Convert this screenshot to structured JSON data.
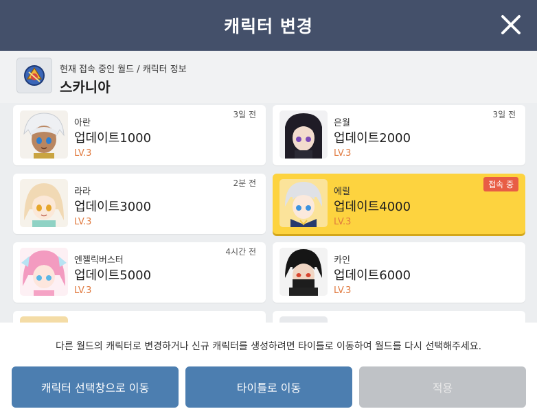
{
  "header": {
    "title": "캐릭터 변경"
  },
  "world": {
    "caption": "현재 접속 중인 월드 / 캐릭터 정보",
    "name": "스카니아"
  },
  "characters": [
    {
      "job": "아란",
      "name": "업데이트1000",
      "level": "LV.3",
      "time": "3일 전",
      "selected": false,
      "portrait": "aran-portrait-icon"
    },
    {
      "job": "은월",
      "name": "업데이트2000",
      "level": "LV.3",
      "time": "3일 전",
      "selected": false,
      "portrait": "eunwol-portrait-icon"
    },
    {
      "job": "라라",
      "name": "업데이트3000",
      "level": "LV.3",
      "time": "2분 전",
      "selected": false,
      "portrait": "lara-portrait-icon"
    },
    {
      "job": "에릴",
      "name": "업데이트4000",
      "level": "LV.3",
      "badge": "접속 중",
      "selected": true,
      "portrait": "eril-portrait-icon"
    },
    {
      "job": "엔젤릭버스터",
      "name": "업데이트5000",
      "level": "LV.3",
      "time": "4시간 전",
      "selected": false,
      "portrait": "angelic-buster-portrait-icon"
    },
    {
      "job": "카인",
      "name": "업데이트6000",
      "level": "LV.3",
      "time": "",
      "selected": false,
      "portrait": "kain-portrait-icon"
    }
  ],
  "footer": {
    "notice": "다른 월드의 캐릭터로 변경하거나 신규 캐릭터를 생성하려면 타이틀로 이동하여 월드를 다시 선택해주세요.",
    "buttons": {
      "select": "캐릭터 선택창으로 이동",
      "title": "타이틀로 이동",
      "apply": "적용"
    }
  },
  "colors": {
    "header_bg": "#44506a",
    "selected_card": "#fdd33f",
    "level_text": "#e07a3f",
    "badge": "#e85d45",
    "primary_button": "#4c7eb0",
    "disabled_button": "#bfc2c6"
  }
}
